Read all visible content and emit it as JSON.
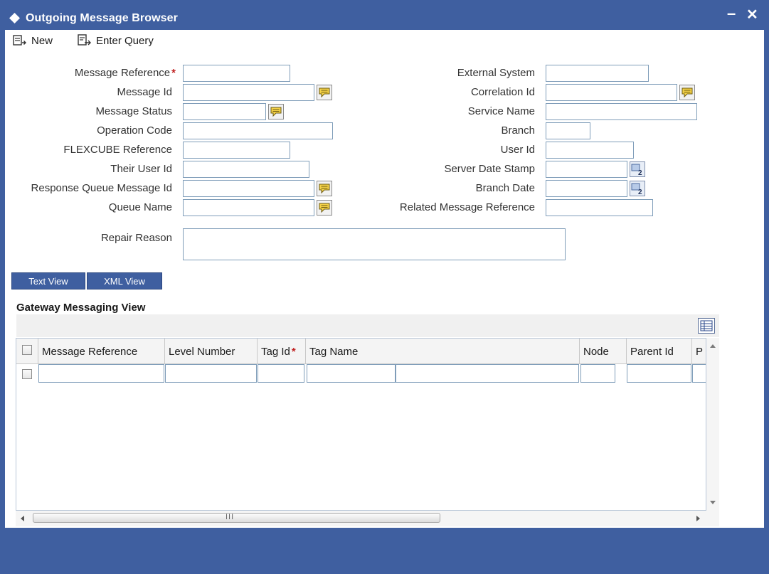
{
  "window": {
    "title": "Outgoing Message Browser",
    "minimize": "–",
    "close": "✕"
  },
  "toolbar": {
    "new_label": "New",
    "enter_query_label": "Enter Query"
  },
  "form": {
    "left": {
      "message_reference": "Message Reference",
      "message_id": "Message Id",
      "message_status": "Message Status",
      "operation_code": "Operation Code",
      "flexcube_reference": "FLEXCUBE Reference",
      "their_user_id": "Their User Id",
      "response_queue_message_id": "Response Queue Message Id",
      "queue_name": "Queue Name"
    },
    "right": {
      "external_system": "External System",
      "correlation_id": "Correlation Id",
      "service_name": "Service Name",
      "branch": "Branch",
      "user_id": "User Id",
      "server_date_stamp": "Server Date Stamp",
      "branch_date": "Branch Date",
      "related_message_reference": "Related Message Reference"
    },
    "repair_reason": "Repair Reason",
    "required_mark": "*"
  },
  "view_tabs": {
    "text_view": "Text View",
    "xml_view": "XML View"
  },
  "gateway": {
    "title": "Gateway Messaging View",
    "columns": [
      "Message Reference",
      "Level Number",
      "Tag Id",
      "Tag Name",
      "Node",
      "Parent Id",
      "P"
    ],
    "required_mark": "*"
  },
  "scroll": {
    "hthumb_grip": "III"
  },
  "colors": {
    "brand": "#3f5fa0",
    "required": "#c02020",
    "input_border": "#7f9db9"
  }
}
